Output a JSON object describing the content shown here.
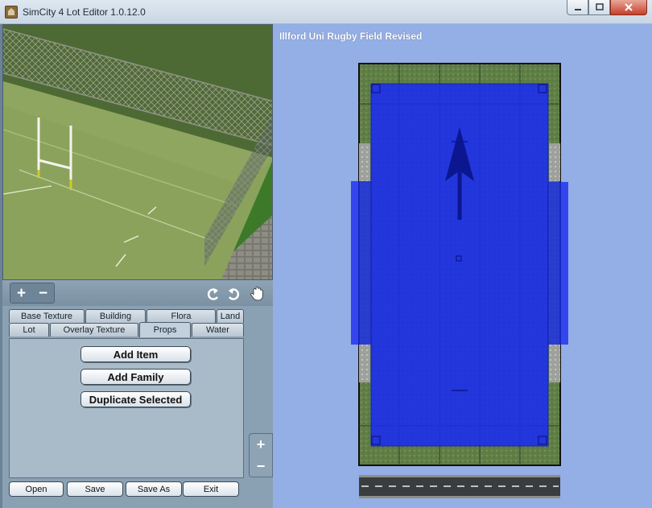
{
  "window": {
    "title": "SimCity 4 Lot Editor 1.0.12.0",
    "minimize_icon": "minimize-icon",
    "maximize_icon": "maximize-icon",
    "close_icon": "close-icon"
  },
  "toolbar": {
    "zoom_in": "+",
    "zoom_out": "−",
    "rotate_left_icon": "rotate-left-icon",
    "rotate_right_icon": "rotate-right-icon",
    "pan_icon": "hand-icon"
  },
  "tabs": {
    "back_row": [
      "Base Texture",
      "Building",
      "Flora",
      "Land"
    ],
    "front_row": [
      "Lot",
      "Overlay Texture",
      "Props",
      "Water"
    ],
    "active": "Props"
  },
  "props_panel": {
    "add_item": "Add Item",
    "add_family": "Add Family",
    "duplicate_selected": "Duplicate Selected"
  },
  "file_buttons": {
    "open": "Open",
    "save": "Save",
    "save_as": "Save As",
    "exit": "Exit"
  },
  "lot": {
    "name": "Illford Uni Rugby Field Revised"
  },
  "colors": {
    "lot_background": "#94aee6",
    "selection_blue": "#1a2cf0",
    "grass": "#5f7f46"
  }
}
